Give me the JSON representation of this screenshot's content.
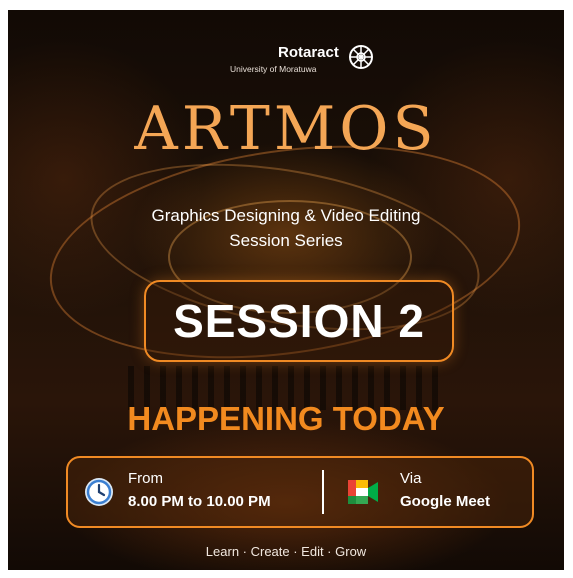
{
  "logo": {
    "name": "Rotaract",
    "sub": "University of Moratuwa"
  },
  "brand": {
    "title": "ARTMOS"
  },
  "subtitle": {
    "line1": "Graphics Designing & Video Editing",
    "line2": "Session Series"
  },
  "session": {
    "label": "SESSION 2"
  },
  "status": {
    "headline": "HAPPENING TODAY"
  },
  "details": {
    "from_label": "From",
    "time": "8.00 PM to 10.00 PM",
    "via_label": "Via",
    "platform": "Google Meet"
  },
  "tagline": "Learn · Create · Edit · Grow",
  "colors": {
    "accent": "#f28a1f",
    "title_gold": "#f4a655",
    "background": "#1d1108"
  },
  "icons": [
    "rotary-wheel-icon",
    "clock-icon",
    "google-meet-icon"
  ]
}
